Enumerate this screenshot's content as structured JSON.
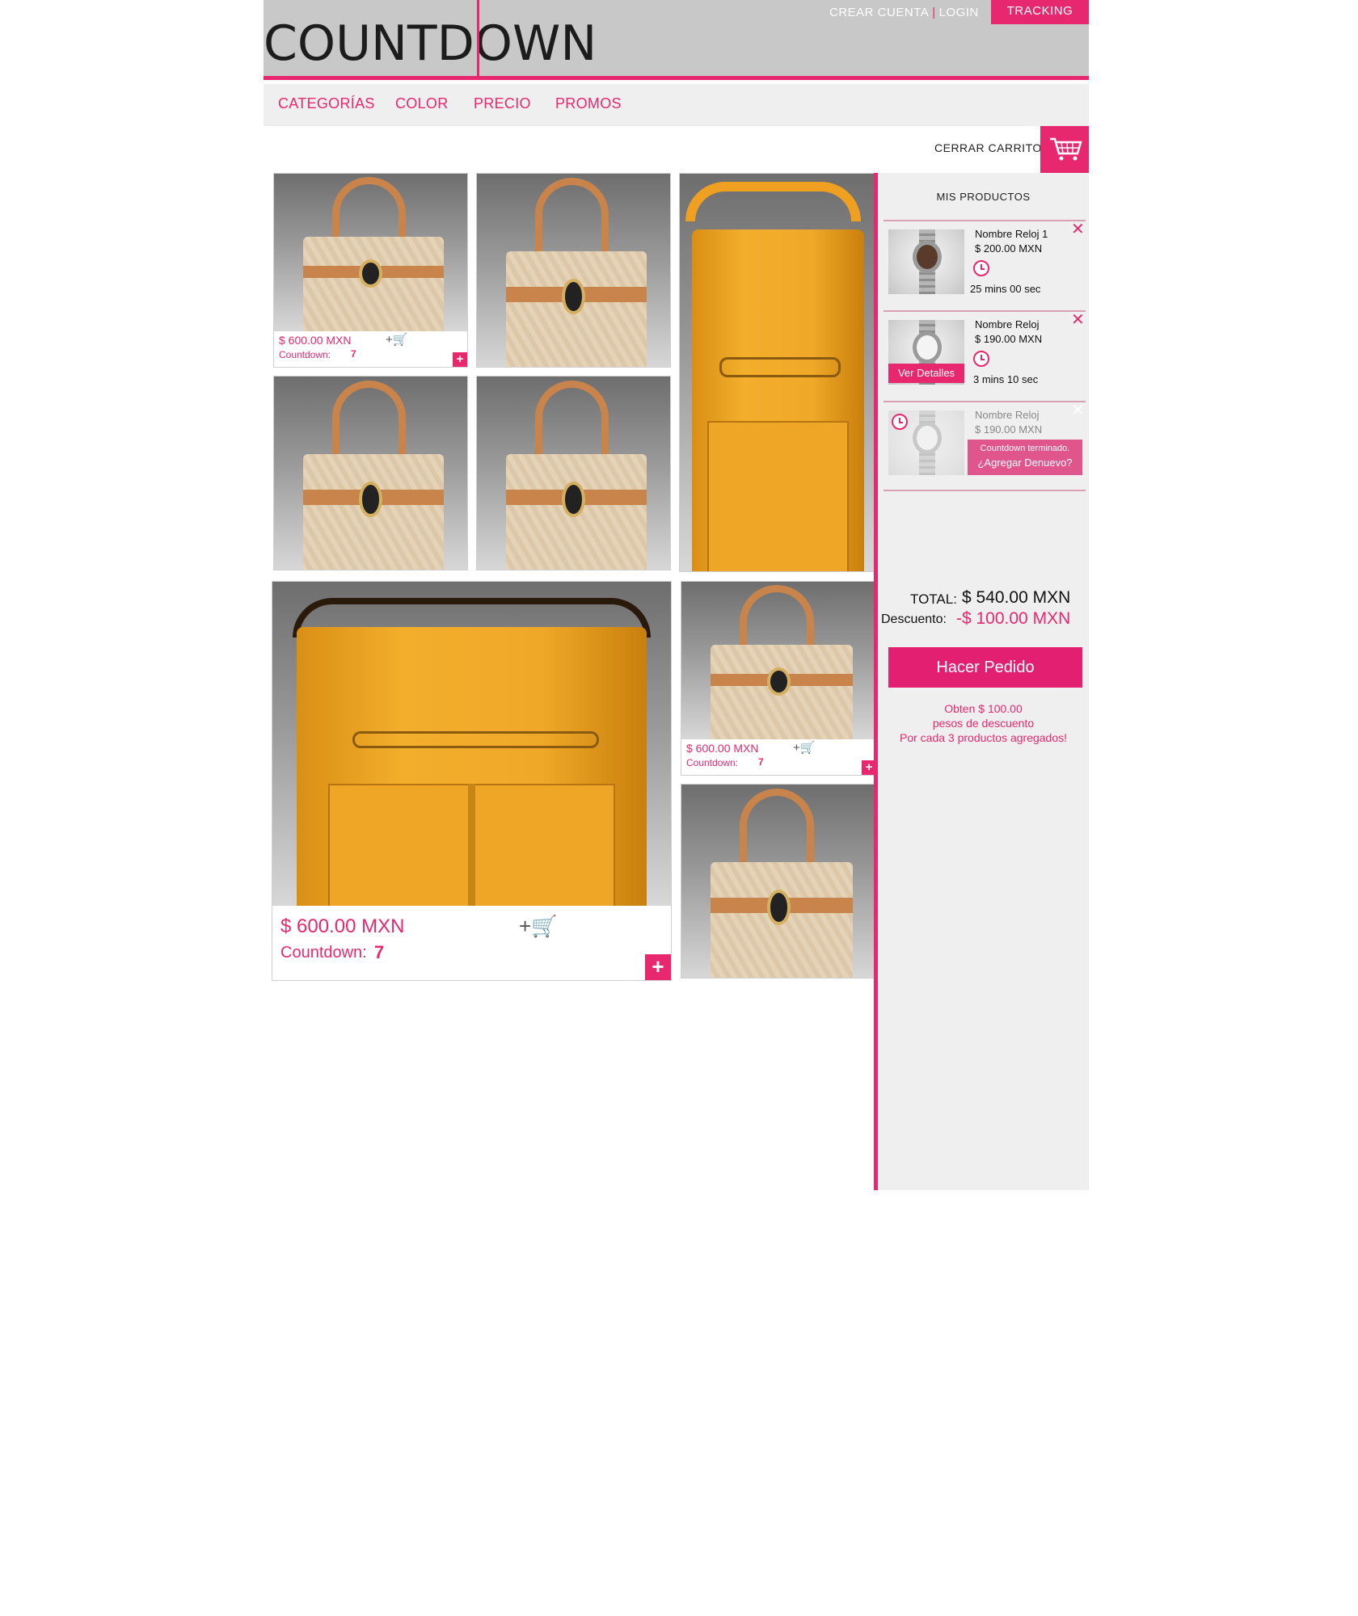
{
  "brand": {
    "logo": "COUNTDOWN"
  },
  "top_links": {
    "create_account": "CREAR CUENTA",
    "separator": "|",
    "login": "LOGIN",
    "tracking": "TRACKING"
  },
  "nav": {
    "items": [
      "CATEGORÍAS",
      "COLOR",
      "PRECIO",
      "PROMOS"
    ]
  },
  "cart_toggle": {
    "label": "CERRAR CARRITO",
    "icon": "cart-icon"
  },
  "products": {
    "small": {
      "price": "$ 600.00 MXN",
      "countdown_label": "Countdown:",
      "countdown_value": "7",
      "add_to_cart": "+🛒",
      "plus": "+"
    },
    "large": {
      "price": "$ 600.00 MXN",
      "countdown_label": "Countdown:",
      "countdown_value": "7",
      "add_to_cart": "+🛒",
      "plus": "+"
    }
  },
  "cart": {
    "title": "MIS PRODUCTOS",
    "items": [
      {
        "name": "Nombre Reloj 1",
        "price": "$ 200.00 MXN",
        "time": "25 mins 00 sec",
        "remove": "✕"
      },
      {
        "name": "Nombre Reloj",
        "price": "$ 190.00 MXN",
        "time": "3 mins 10 sec",
        "remove": "✕",
        "details_button": "Ver Detalles"
      },
      {
        "name": "Nombre Reloj",
        "price": "$ 190.00 MXN",
        "remove": "✕",
        "expired_line1": "Countdown terminado.",
        "expired_line2": "¿Agregar Denuevo?"
      }
    ],
    "total_label": "TOTAL:",
    "total_value": "$ 540.00 MXN",
    "discount_label": "Descuento:",
    "discount_value": "-$ 100.00 MXN",
    "order_button": "Hacer Pedido",
    "promo_line1": "Obten $ 100.00",
    "promo_line2": "pesos de descuento",
    "promo_line3": "Por cada 3 productos agregados!"
  },
  "colors": {
    "accent": "#e8286e",
    "header_bg": "#c8c8c8",
    "nav_bg": "#efefef",
    "panel_bg": "#efefef"
  }
}
